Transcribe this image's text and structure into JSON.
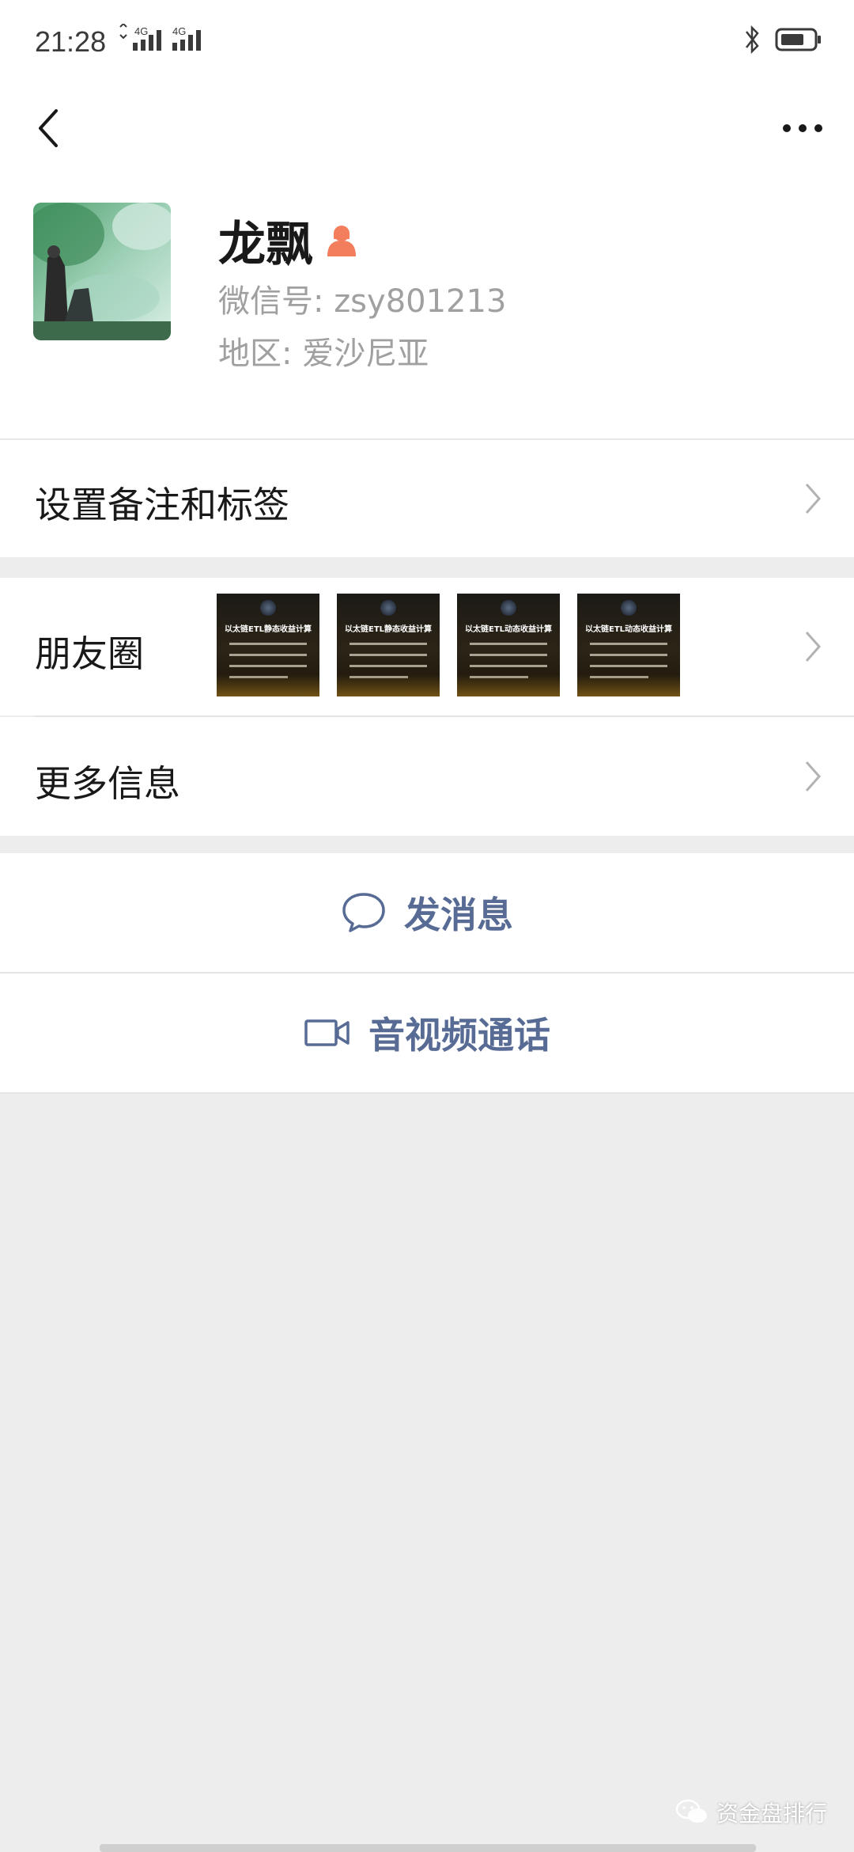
{
  "status_bar": {
    "time": "21:28",
    "network_1": "4G",
    "network_2": "4G"
  },
  "profile": {
    "name": "龙飘",
    "wechat_id": "微信号: zsy801213",
    "region": "地区: 爱沙尼亚",
    "gender_icon": "female-icon",
    "gender_color": "#f37e5e"
  },
  "rows": {
    "remark": "设置备注和标签",
    "moments": "朋友圈",
    "more_info": "更多信息"
  },
  "moments_thumbs": [
    {
      "title": "以太链ETL静态收益计算"
    },
    {
      "title": "以太链ETL静态收益计算"
    },
    {
      "title": "以太链ETL动态收益计算"
    },
    {
      "title": "以太链ETL动态收益计算"
    }
  ],
  "actions": {
    "message": "发消息",
    "video_call": "音视频通话"
  },
  "watermark": "资金盘排行",
  "colors": {
    "link_blue": "#576b95",
    "background": "#ededed"
  }
}
